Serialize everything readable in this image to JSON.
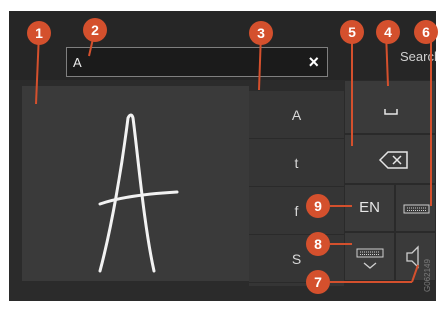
{
  "search_field": {
    "value": "A",
    "clear_glyph": "×"
  },
  "search_button_label": "Search",
  "handwriting": {
    "character": "A"
  },
  "candidates": [
    "A",
    "t",
    "f",
    "S"
  ],
  "keys": {
    "language": "EN"
  },
  "callouts": [
    "1",
    "2",
    "3",
    "4",
    "5",
    "6",
    "7",
    "8",
    "9"
  ],
  "image_code": "G062149",
  "colors": {
    "accent": "#d4502d",
    "panel": "#3a3a3a",
    "background": "#2b2b2b"
  }
}
